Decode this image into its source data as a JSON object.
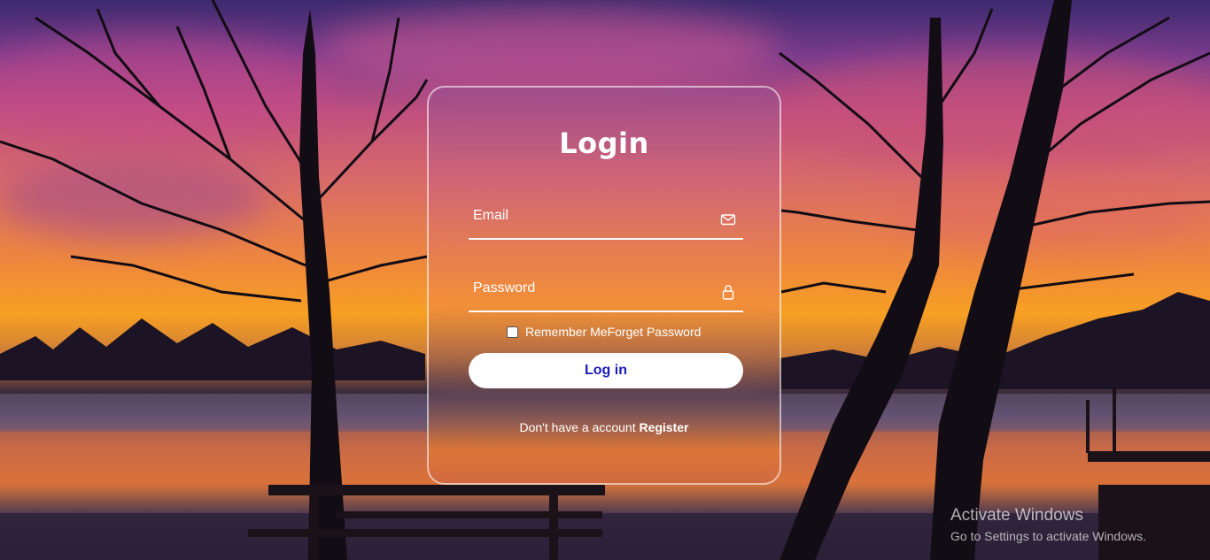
{
  "login": {
    "title": "Login",
    "email_placeholder": "Email",
    "password_placeholder": "Password",
    "remember_label": "Remember Me",
    "forgot_label": "Forget Password",
    "submit_label": "Log in",
    "register_prompt": "Don't have a account ",
    "register_link": "Register",
    "icons": {
      "email": "envelope-icon",
      "password": "lock-icon"
    },
    "colors": {
      "button_text": "#1a1ab8",
      "button_bg": "#ffffff",
      "card_border": "#ffffff"
    }
  },
  "watermark": {
    "title": "Activate Windows",
    "subtitle": "Go to Settings to activate Windows."
  }
}
